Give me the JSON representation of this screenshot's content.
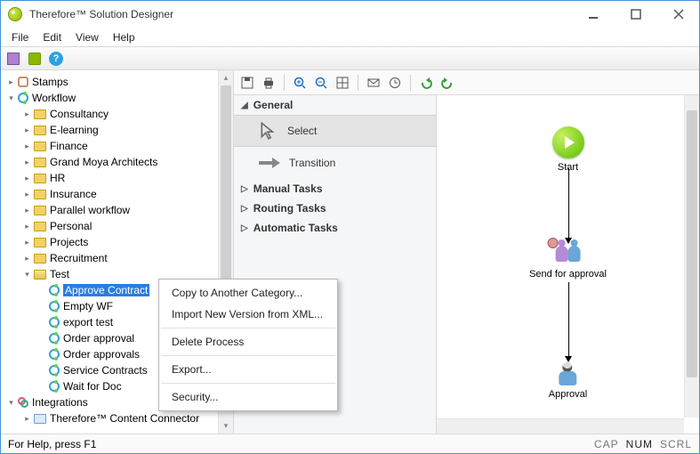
{
  "window": {
    "title": "Therefore™ Solution Designer"
  },
  "menu": {
    "file": "File",
    "edit": "Edit",
    "view": "View",
    "help": "Help"
  },
  "tree": {
    "stamps": "Stamps",
    "workflow": "Workflow",
    "workflow_children": [
      "Consultancy",
      "E-learning",
      "Finance",
      "Grand Moya Architects",
      "HR",
      "Insurance",
      "Parallel workflow",
      "Personal",
      "Projects",
      "Recruitment",
      "Test"
    ],
    "test_children": [
      "Approve Contract",
      "Empty WF",
      "export test",
      "Order approval",
      "Order approvals",
      "Service Contracts",
      "Wait for Doc"
    ],
    "integrations": "Integrations",
    "tcc": "Therefore™ Content Connector"
  },
  "palette": {
    "general": "General",
    "select": "Select",
    "transition": "Transition",
    "manual": "Manual Tasks",
    "routing": "Routing Tasks",
    "automatic": "Automatic Tasks"
  },
  "flow": {
    "start": "Start",
    "send": "Send for approval",
    "approval": "Approval"
  },
  "ctx": {
    "copy": "Copy to Another Category...",
    "import": "Import New Version from XML...",
    "delete": "Delete Process",
    "export": "Export...",
    "security": "Security..."
  },
  "status": {
    "hint": "For Help, press F1",
    "cap": "CAP",
    "num": "NUM",
    "scrl": "SCRL"
  }
}
